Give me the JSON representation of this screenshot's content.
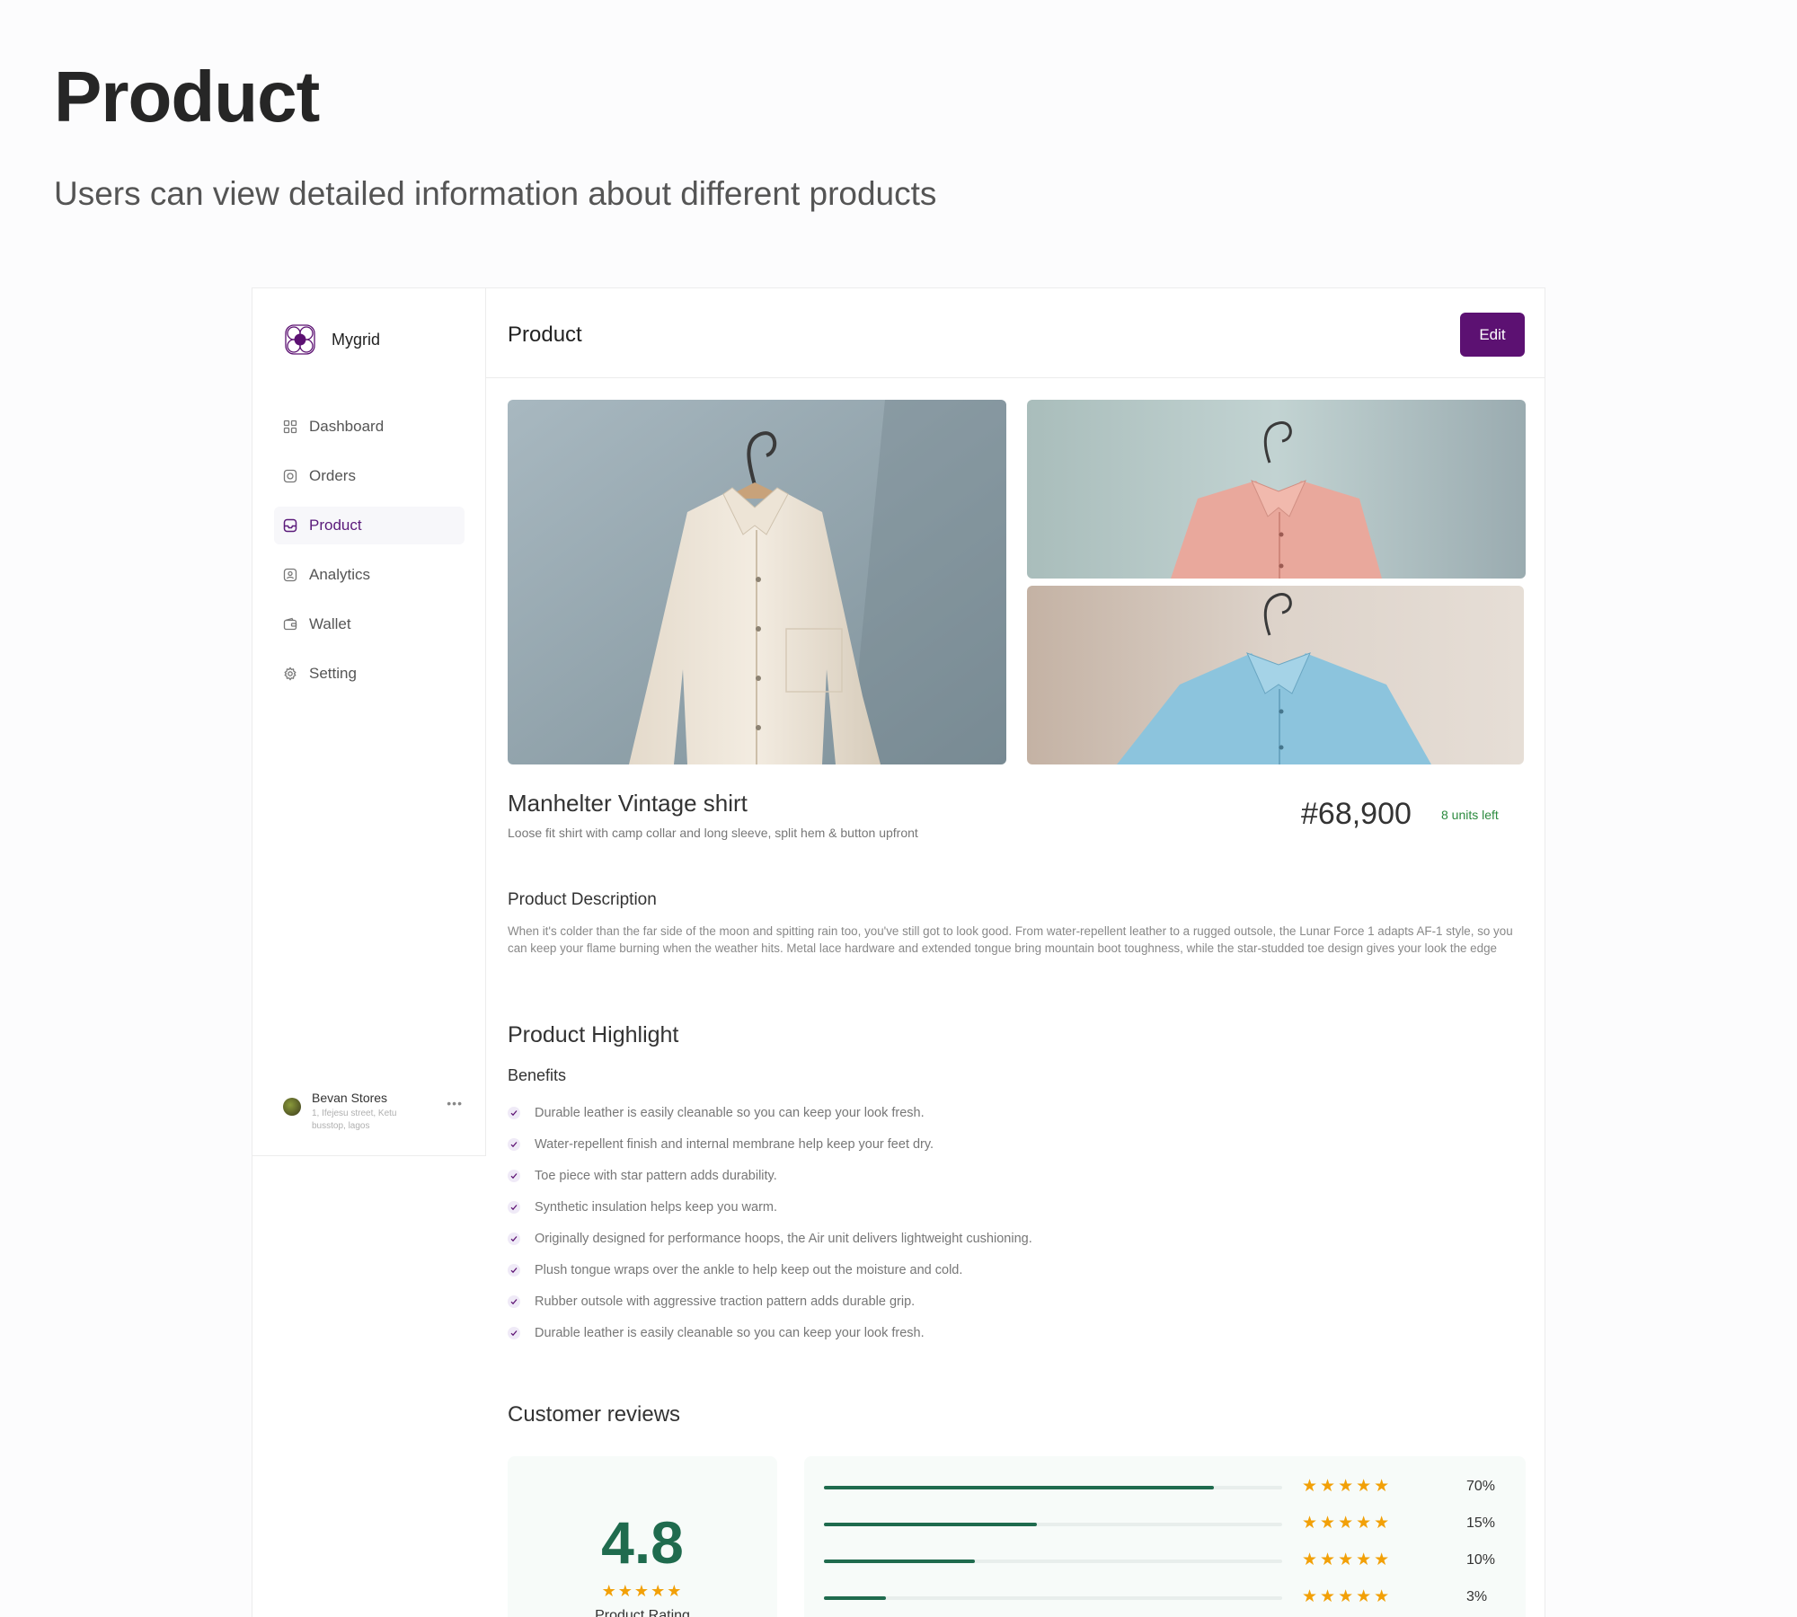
{
  "hero": {
    "title": "Product",
    "subtitle": "Users can view detailed information about different products"
  },
  "brand": {
    "name": "Mygrid",
    "logo_icon": "grid-flower-logo"
  },
  "sidebar": {
    "items": [
      {
        "label": "Dashboard",
        "icon": "grid-icon",
        "active": false
      },
      {
        "label": "Orders",
        "icon": "orders-icon",
        "active": false
      },
      {
        "label": "Product",
        "icon": "product-icon",
        "active": true
      },
      {
        "label": "Analytics",
        "icon": "analytics-icon",
        "active": false
      },
      {
        "label": "Wallet",
        "icon": "wallet-icon",
        "active": false
      },
      {
        "label": "Setting",
        "icon": "gear-icon",
        "active": false
      }
    ],
    "store": {
      "name": "Bevan Stores",
      "address": "1, Ifejesu street, Ketu busstop, lagos",
      "more_icon": "more-horizontal-icon"
    }
  },
  "topbar": {
    "title": "Product",
    "edit_label": "Edit"
  },
  "product": {
    "name": "Manhelter Vintage shirt",
    "tagline": "Loose fit shirt with camp collar and long sleeve, split hem & button upfront",
    "price": "#68,900",
    "stock": "8 units left",
    "description_title": "Product Description",
    "description": "When it's colder than the far side of the moon and spitting rain too, you've still got to look good. From water-repellent leather to a rugged outsole, the Lunar Force 1 adapts AF-1 style, so you can keep your flame burning when the weather hits. Metal lace hardware and extended tongue bring mountain boot toughness, while the star-studded toe design gives your look the edge"
  },
  "highlight": {
    "title": "Product Highlight",
    "benefits_title": "Benefits",
    "benefits": [
      "Durable leather is easily cleanable so you can keep your look fresh.",
      "Water-repellent finish and internal membrane help keep your feet dry.",
      "Toe piece with star pattern adds durability.",
      "Synthetic insulation helps keep you warm.",
      "Originally designed for performance hoops, the Air unit delivers lightweight cushioning.",
      "Plush tongue wraps over the ankle to help keep out the moisture and cold.",
      "Rubber outsole with aggressive traction pattern adds durable grip.",
      "Durable leather is easily cleanable so you can keep your look fresh."
    ]
  },
  "reviews": {
    "title": "Customer reviews",
    "rating": "4.8",
    "rating_label": "Product Rating",
    "distribution": [
      {
        "percent": "70%",
        "fill": 0.85
      },
      {
        "percent": "15%",
        "fill": 0.465
      },
      {
        "percent": "10%",
        "fill": 0.33
      },
      {
        "percent": "3%",
        "fill": 0.135
      }
    ]
  },
  "colors": {
    "accent": "#5c1172",
    "success": "#2b8a3e",
    "rating_green": "#1f6b4e",
    "star": "#f2a007"
  }
}
